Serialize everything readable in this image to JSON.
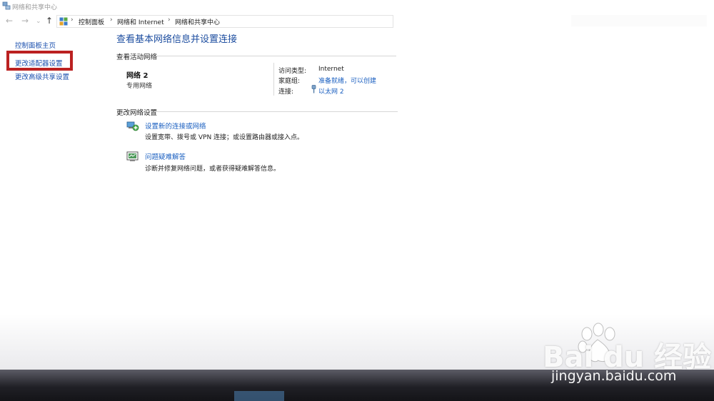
{
  "window": {
    "title": "网络和共享中心"
  },
  "navigation": {
    "back_glyph": "←",
    "forward_glyph": "→",
    "recent_glyph": "⌄",
    "up_glyph": "↑"
  },
  "breadcrumb": {
    "separator": "›",
    "items": [
      "控制面板",
      "网络和 Internet",
      "网络和共享中心"
    ]
  },
  "sidebar": {
    "items": [
      {
        "label": "控制面板主页"
      },
      {
        "label": "更改适配器设置"
      },
      {
        "label": "更改高级共享设置"
      }
    ],
    "highlight_color": "#bb2121"
  },
  "main": {
    "heading": "查看基本网络信息并设置连接",
    "active_section_label": "查看活动网络",
    "network": {
      "name": "网络  2",
      "type": "专用网络",
      "access_type_label": "访问类型:",
      "access_type_value": "Internet",
      "homegroup_label": "家庭组:",
      "homegroup_value": "准备就绪，可以创建",
      "connection_label": "连接:",
      "connection_value": "以太网 2"
    },
    "change_section_label": "更改网络设置",
    "tasks": [
      {
        "title": "设置新的连接或网络",
        "description": "设置宽带、拨号或 VPN 连接；或设置路由器或接入点。",
        "icon": "network-setup-icon"
      },
      {
        "title": "问题疑难解答",
        "description": "诊断并修复网络问题，或者获得疑难解答信息。",
        "icon": "troubleshoot-icon"
      }
    ]
  },
  "watermark": {
    "logo": "Bai du 经验",
    "url": "jingyan.baidu.com"
  },
  "colors": {
    "link": "#1a5fc0",
    "heading": "#1e4ea0",
    "accent_box": "#bb2121"
  }
}
